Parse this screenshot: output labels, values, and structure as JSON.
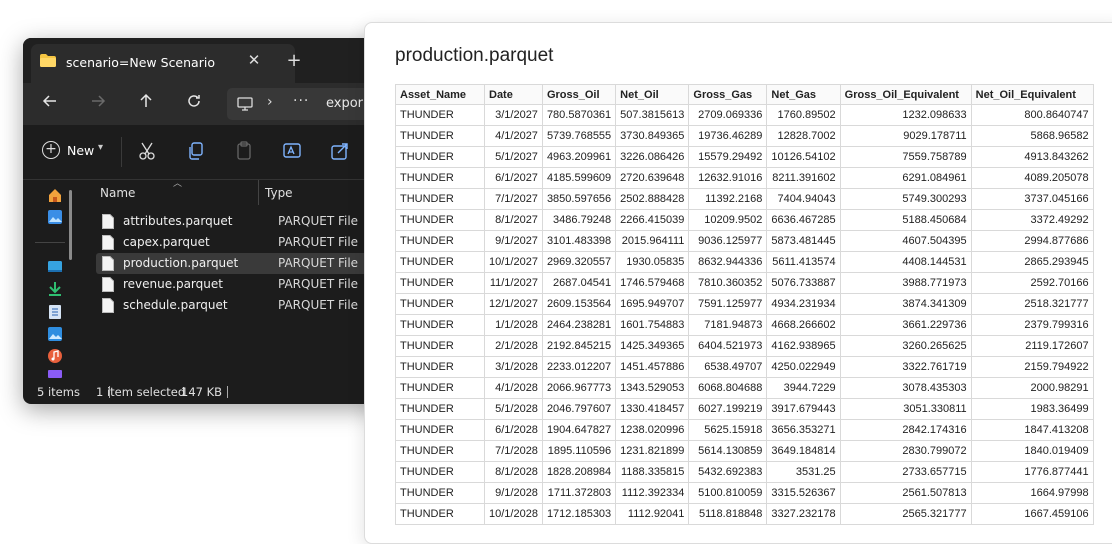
{
  "explorer": {
    "tab_title": "scenario=New Scenario",
    "tab_close": "✕",
    "new_tab": "+",
    "address_crumb": "expor",
    "new_label": "New",
    "columns": {
      "name": "Name",
      "type": "Type"
    },
    "files": [
      {
        "name": "attributes.parquet",
        "type": "PARQUET File",
        "selected": false
      },
      {
        "name": "capex.parquet",
        "type": "PARQUET File",
        "selected": false
      },
      {
        "name": "production.parquet",
        "type": "PARQUET File",
        "selected": true
      },
      {
        "name": "revenue.parquet",
        "type": "PARQUET File",
        "selected": false
      },
      {
        "name": "schedule.parquet",
        "type": "PARQUET File",
        "selected": false
      }
    ],
    "status": {
      "items": "5 items",
      "selected": "1 item selected",
      "size": "147 KB"
    }
  },
  "preview": {
    "title": "production.parquet",
    "headers": [
      "Asset_Name",
      "Date",
      "Gross_Oil",
      "Net_Oil",
      "Gross_Gas",
      "Net_Gas",
      "Gross_Oil_Equivalent",
      "Net_Oil_Equivalent"
    ],
    "rows": [
      [
        "THUNDER",
        "3/1/2027",
        "780.5870361",
        "507.3815613",
        "2709.069336",
        "1760.89502",
        "1232.098633",
        "800.8640747"
      ],
      [
        "THUNDER",
        "4/1/2027",
        "5739.768555",
        "3730.849365",
        "19736.46289",
        "12828.7002",
        "9029.178711",
        "5868.96582"
      ],
      [
        "THUNDER",
        "5/1/2027",
        "4963.209961",
        "3226.086426",
        "15579.29492",
        "10126.54102",
        "7559.758789",
        "4913.843262"
      ],
      [
        "THUNDER",
        "6/1/2027",
        "4185.599609",
        "2720.639648",
        "12632.91016",
        "8211.391602",
        "6291.084961",
        "4089.205078"
      ],
      [
        "THUNDER",
        "7/1/2027",
        "3850.597656",
        "2502.888428",
        "11392.2168",
        "7404.94043",
        "5749.300293",
        "3737.045166"
      ],
      [
        "THUNDER",
        "8/1/2027",
        "3486.79248",
        "2266.415039",
        "10209.9502",
        "6636.467285",
        "5188.450684",
        "3372.49292"
      ],
      [
        "THUNDER",
        "9/1/2027",
        "3101.483398",
        "2015.964111",
        "9036.125977",
        "5873.481445",
        "4607.504395",
        "2994.877686"
      ],
      [
        "THUNDER",
        "10/1/2027",
        "2969.320557",
        "1930.05835",
        "8632.944336",
        "5611.413574",
        "4408.144531",
        "2865.293945"
      ],
      [
        "THUNDER",
        "11/1/2027",
        "2687.04541",
        "1746.579468",
        "7810.360352",
        "5076.733887",
        "3988.771973",
        "2592.70166"
      ],
      [
        "THUNDER",
        "12/1/2027",
        "2609.153564",
        "1695.949707",
        "7591.125977",
        "4934.231934",
        "3874.341309",
        "2518.321777"
      ],
      [
        "THUNDER",
        "1/1/2028",
        "2464.238281",
        "1601.754883",
        "7181.94873",
        "4668.266602",
        "3661.229736",
        "2379.799316"
      ],
      [
        "THUNDER",
        "2/1/2028",
        "2192.845215",
        "1425.349365",
        "6404.521973",
        "4162.938965",
        "3260.265625",
        "2119.172607"
      ],
      [
        "THUNDER",
        "3/1/2028",
        "2233.012207",
        "1451.457886",
        "6538.49707",
        "4250.022949",
        "3322.761719",
        "2159.794922"
      ],
      [
        "THUNDER",
        "4/1/2028",
        "2066.967773",
        "1343.529053",
        "6068.804688",
        "3944.7229",
        "3078.435303",
        "2000.98291"
      ],
      [
        "THUNDER",
        "5/1/2028",
        "2046.797607",
        "1330.418457",
        "6027.199219",
        "3917.679443",
        "3051.330811",
        "1983.36499"
      ],
      [
        "THUNDER",
        "6/1/2028",
        "1904.647827",
        "1238.020996",
        "5625.15918",
        "3656.353271",
        "2842.174316",
        "1847.413208"
      ],
      [
        "THUNDER",
        "7/1/2028",
        "1895.110596",
        "1231.821899",
        "5614.130859",
        "3649.184814",
        "2830.799072",
        "1840.019409"
      ],
      [
        "THUNDER",
        "8/1/2028",
        "1828.208984",
        "1188.335815",
        "5432.692383",
        "3531.25",
        "2733.657715",
        "1776.877441"
      ],
      [
        "THUNDER",
        "9/1/2028",
        "1711.372803",
        "1112.392334",
        "5100.810059",
        "3315.526367",
        "2561.507813",
        "1664.97998"
      ],
      [
        "THUNDER",
        "10/1/2028",
        "1712.185303",
        "1112.92041",
        "5118.818848",
        "3327.232178",
        "2565.321777",
        "1667.459106"
      ]
    ]
  }
}
